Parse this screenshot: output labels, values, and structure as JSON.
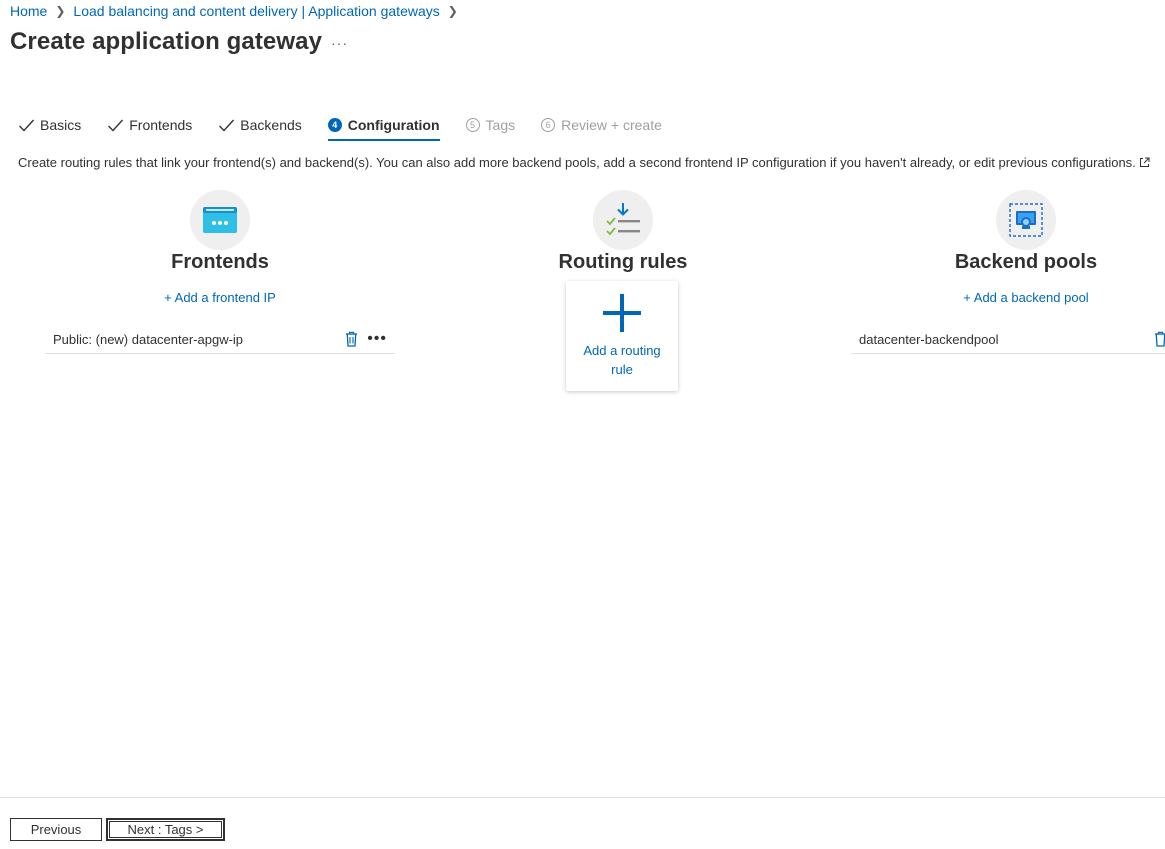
{
  "breadcrumb": {
    "items": [
      "Home",
      "Load balancing and content delivery | Application gateways"
    ]
  },
  "page": {
    "title": "Create application gateway",
    "more": "···"
  },
  "tabs": [
    {
      "label": "Basics",
      "state": "completed"
    },
    {
      "label": "Frontends",
      "state": "completed"
    },
    {
      "label": "Backends",
      "state": "completed"
    },
    {
      "label": "Configuration",
      "number": "4",
      "state": "active"
    },
    {
      "label": "Tags",
      "number": "5",
      "state": "disabled"
    },
    {
      "label": "Review + create",
      "number": "6",
      "state": "disabled"
    }
  ],
  "description": "Create routing rules that link your frontend(s) and backend(s). You can also add more backend pools, add a second frontend IP configuration if you haven't already, or edit previous configurations.",
  "frontends": {
    "title": "Frontends",
    "add_link": "+ Add a frontend IP",
    "items": [
      "Public: (new) datacenter-apgw-ip"
    ],
    "icon": "frontend-window-icon"
  },
  "routing": {
    "title": "Routing rules",
    "add_line1": "Add a routing",
    "add_line2": "rule",
    "icon": "routing-rules-icon"
  },
  "backends": {
    "title": "Backend pools",
    "add_link": "+ Add a backend pool",
    "items": [
      "datacenter-backendpool"
    ],
    "icon": "backend-pool-icon"
  },
  "footer": {
    "previous": "Previous",
    "next": "Next : Tags >"
  },
  "colors": {
    "link": "#0067b8",
    "text": "#323130",
    "disabled": "#a19f9d"
  }
}
